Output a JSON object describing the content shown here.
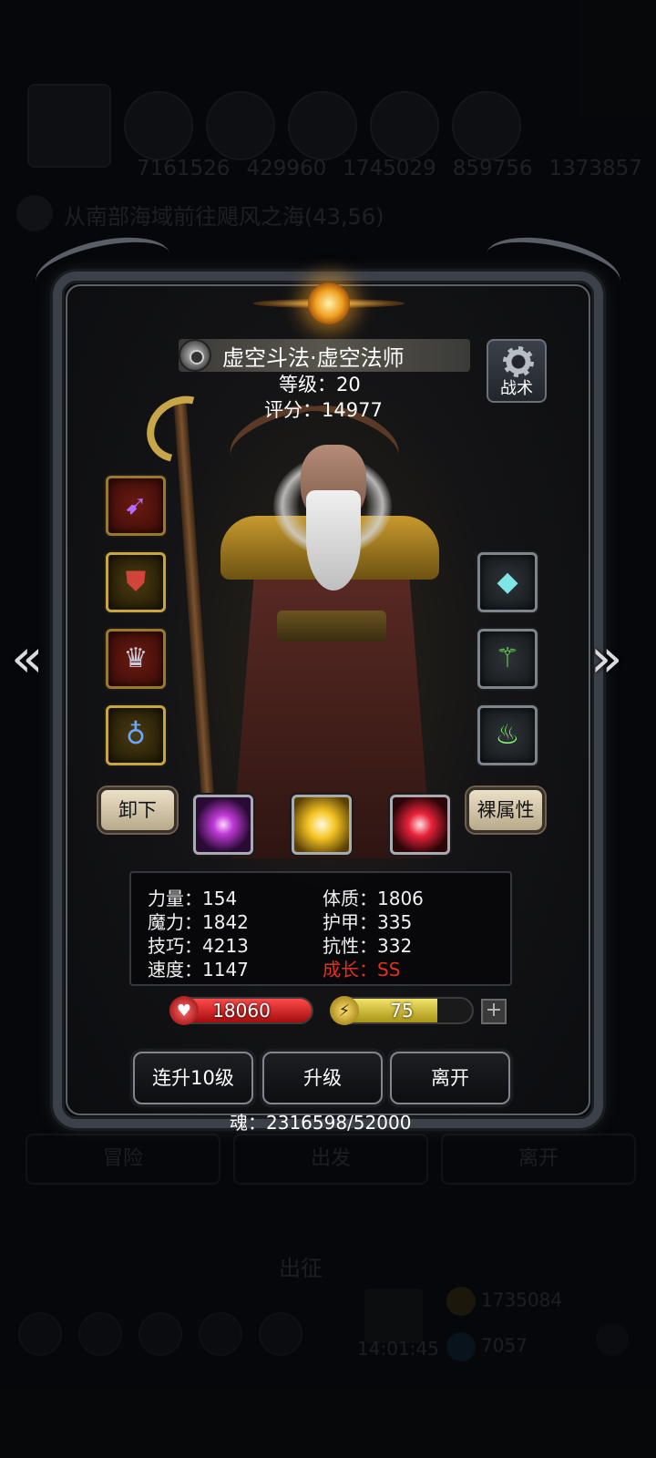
{
  "background": {
    "resources": [
      "7161526",
      "429960",
      "1745029",
      "859756",
      "1373857"
    ],
    "route": "从南部海域前往飓风之海(43,56)",
    "tabs": [
      "冒险",
      "出发",
      "离开"
    ],
    "sortie_label": "出征",
    "clock": "14:01:45",
    "gold": "1735084",
    "gems": "7057"
  },
  "hero": {
    "title": "虚空斗法·虚空法师",
    "level": "等级：20",
    "score": "评分：14977",
    "tactic_label": "战术"
  },
  "equipment": {
    "left": [
      {
        "icon": "purple-spear-icon",
        "frame": "red"
      },
      {
        "icon": "red-armor-icon",
        "frame": "gold"
      },
      {
        "icon": "helmet-icon",
        "frame": "red"
      },
      {
        "icon": "amulet-icon",
        "frame": "gold"
      }
    ],
    "right": [
      {
        "icon": "crystal-gem-icon",
        "frame": "gray"
      },
      {
        "icon": "green-staff-icon",
        "frame": "gray"
      },
      {
        "icon": "lantern-icon",
        "frame": "gray"
      }
    ]
  },
  "skills": [
    {
      "icon": "violet-flame-skill-icon",
      "color": "#c03ad8"
    },
    {
      "icon": "golden-burst-skill-icon",
      "color": "#f5c524"
    },
    {
      "icon": "red-slash-skill-icon",
      "color": "#e8223a"
    }
  ],
  "buttons": {
    "unequip": "卸下",
    "base_attributes": "裸属性",
    "level_up_10": "连升10级",
    "level_up": "升级",
    "leave": "离开"
  },
  "stats": {
    "strength": "力量：154",
    "magic": "魔力：1842",
    "skill": "技巧：4213",
    "speed": "速度：1147",
    "constitution": "体质：1806",
    "armor": "护甲：335",
    "resistance": "抗性：332",
    "growth": "成长：SS"
  },
  "bars": {
    "hp_value": "18060",
    "hp_fill": 1.0,
    "energy_value": "75",
    "energy_fill": 0.75
  },
  "soul": "魂：2316598/52000",
  "colors": {
    "hp": "#d41818",
    "energy": "#d8c53a",
    "growth": "#e0331e"
  }
}
